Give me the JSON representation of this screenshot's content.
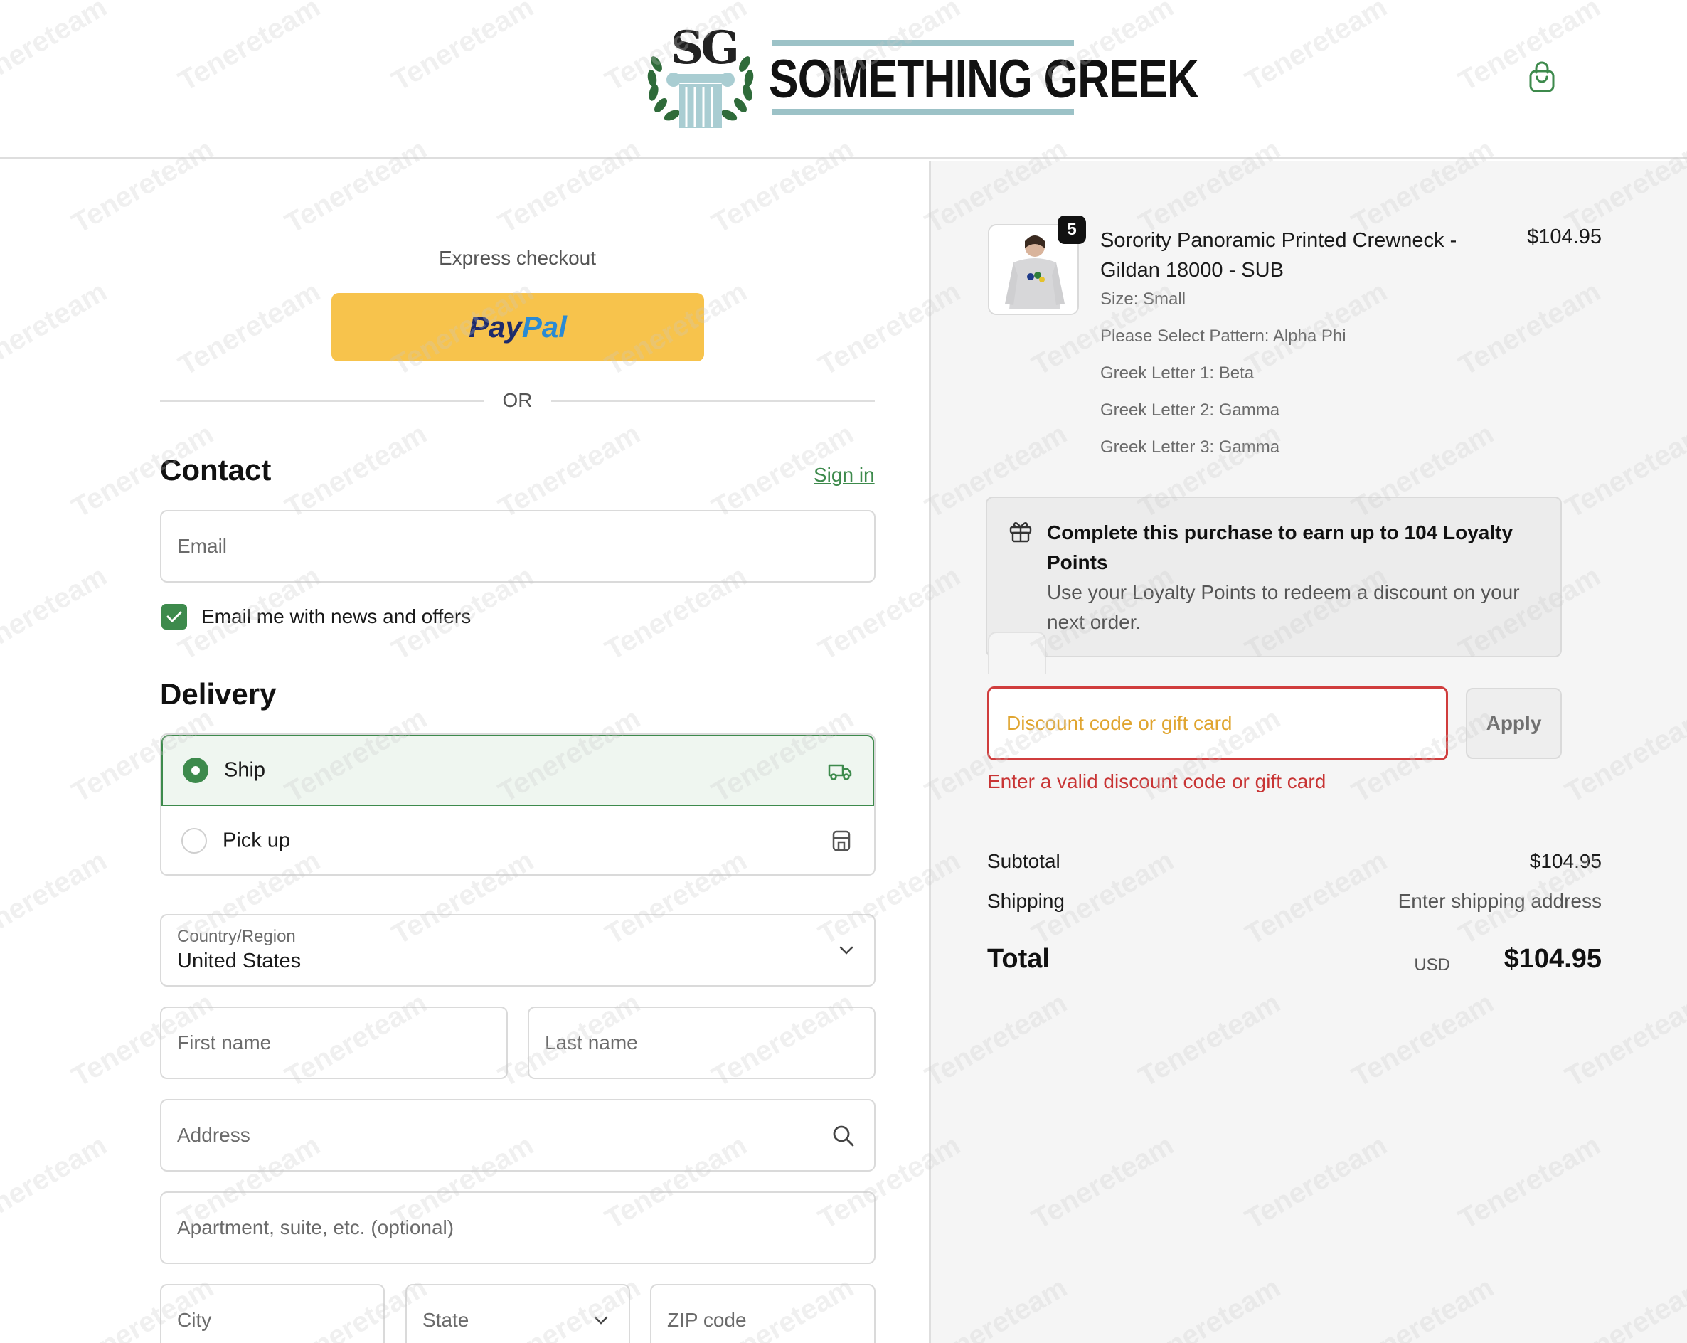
{
  "header": {
    "logo_monogram": "SG",
    "logo_text": "SOMETHING GREEK",
    "cart_icon": "shopping-bag-icon"
  },
  "express": {
    "title": "Express checkout",
    "paypal_pay": "Pay",
    "paypal_pal": "Pal",
    "or_label": "OR"
  },
  "contact": {
    "title": "Contact",
    "sign_in": "Sign in",
    "email_placeholder": "Email",
    "newsletter_label": "Email me with news and offers",
    "newsletter_checked": true
  },
  "delivery": {
    "title": "Delivery",
    "options": [
      {
        "label": "Ship",
        "selected": true,
        "icon": "truck-icon"
      },
      {
        "label": "Pick up",
        "selected": false,
        "icon": "store-icon"
      }
    ],
    "country_label": "Country/Region",
    "country_value": "United States",
    "first_name_placeholder": "First name",
    "last_name_placeholder": "Last name",
    "address_placeholder": "Address",
    "apartment_placeholder": "Apartment, suite, etc. (optional)",
    "city_placeholder": "City",
    "state_placeholder": "State",
    "zip_placeholder": "ZIP code"
  },
  "order": {
    "quantity": "5",
    "product_title": "Sorority Panoramic Printed Crewneck - Gildan 18000 - SUB",
    "price": "$104.95",
    "options": [
      "Size: Small",
      "Please Select Pattern: Alpha Phi",
      "Greek Letter 1: Beta",
      "Greek Letter 2: Gamma",
      "Greek Letter 3: Gamma"
    ]
  },
  "loyalty": {
    "title": "Complete this purchase to earn up to 104 Loyalty Points",
    "description": "Use your Loyalty Points to redeem a discount on your next order."
  },
  "discount": {
    "placeholder": "Discount code or gift card",
    "apply_label": "Apply",
    "error": "Enter a valid discount code or gift card"
  },
  "summary": {
    "subtotal_label": "Subtotal",
    "subtotal_value": "$104.95",
    "shipping_label": "Shipping",
    "shipping_value": "Enter shipping address",
    "total_label": "Total",
    "currency": "USD",
    "total_value": "$104.95"
  },
  "colors": {
    "accent_green": "#3d8a4c",
    "paypal_yellow": "#f7c34c",
    "error_red": "#c83434"
  },
  "watermark_text": "Tenereteam"
}
